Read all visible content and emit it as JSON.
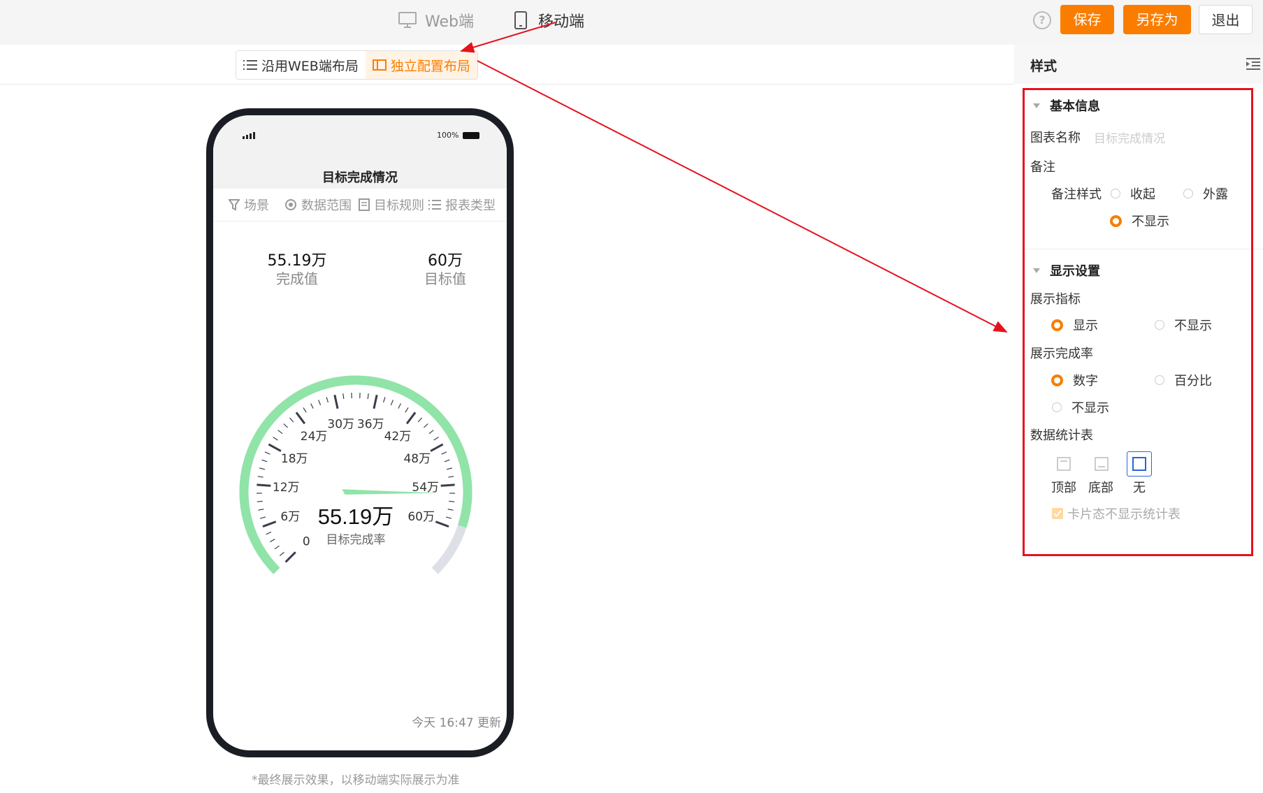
{
  "topbar": {
    "web_tab": "Web端",
    "mobile_tab": "移动端",
    "save_label": "保存",
    "save_as_label": "另存为",
    "exit_label": "退出"
  },
  "layout_toggle": {
    "inherit_label": "沿用WEB端布局",
    "independent_label": "独立配置布局",
    "selected": "独立配置布局"
  },
  "phone": {
    "status_battery": "100%",
    "title": "目标完成情况",
    "filters": [
      "场景",
      "数据范围",
      "目标规则",
      "报表类型"
    ],
    "kpis": [
      {
        "value": "55.19万",
        "label": "完成值"
      },
      {
        "value": "60万",
        "label": "目标值"
      }
    ],
    "gauge": {
      "ticks": [
        "0",
        "6万",
        "12万",
        "18万",
        "24万",
        "30万",
        "36万",
        "42万",
        "48万",
        "54万",
        "60万"
      ],
      "value_text": "55.19万",
      "caption": "目标完成率",
      "completed": 55.19,
      "target": 60,
      "track_max": 66,
      "progress_color": "#90e4a8",
      "track_color": "#dde0e6"
    },
    "updated": "今天 16:47 更新"
  },
  "footnote": "*最终展示效果，以移动端实际展示为准",
  "panel": {
    "title": "样式",
    "basic": {
      "title": "基本信息",
      "chart_name_label": "图表名称",
      "chart_name_placeholder": "目标完成情况",
      "remark_label": "备注",
      "remark_style_label": "备注样式",
      "remark_options": [
        "收起",
        "外露",
        "不显示"
      ],
      "remark_selected": "不显示"
    },
    "display": {
      "title": "显示设置",
      "indicator_label": "展示指标",
      "indicator_options": [
        "显示",
        "不显示"
      ],
      "indicator_selected": "显示",
      "rate_label": "展示完成率",
      "rate_options": [
        "数字",
        "百分比",
        "不显示"
      ],
      "rate_selected": "数字",
      "table_label": "数据统计表",
      "table_options": [
        "顶部",
        "底部",
        "无"
      ],
      "table_selected": "无",
      "card_checkbox": "卡片态不显示统计表",
      "card_checked": true
    }
  },
  "accent_color": "#fa7d00",
  "annotation_color": "#e5121e"
}
